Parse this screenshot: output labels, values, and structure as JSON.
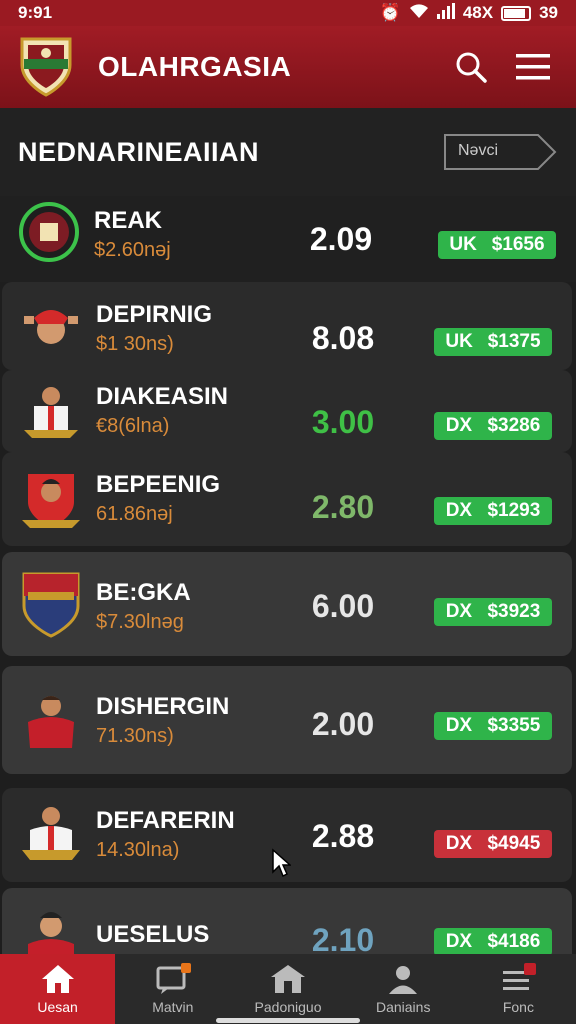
{
  "status_bar": {
    "time": "9:91",
    "signal_text": "48X",
    "battery": "39"
  },
  "header": {
    "title": "OLAHRGASIA",
    "search_icon": "search-icon",
    "menu_icon": "menu-icon"
  },
  "section": {
    "title": "NEDNARINEAIIAN",
    "next_label": "Nəvci"
  },
  "rows": [
    {
      "name": "REAK",
      "sub": "$2.60nəj",
      "odds": "2.09",
      "odds_color": "#ffffff",
      "pill_code": "UK",
      "pill_amount": "$1656",
      "pill_color": "green"
    },
    {
      "name": "DEPIRNIG",
      "sub": "$1 30ns)",
      "odds": "8.08",
      "odds_color": "#ffffff",
      "pill_code": "UK",
      "pill_amount": "$1375",
      "pill_color": "green"
    },
    {
      "name": "DIAKEASIN",
      "sub": "€8(6lna)",
      "odds": "3.00",
      "odds_color": "#3fc046",
      "pill_code": "DX",
      "pill_amount": "$3286",
      "pill_color": "green"
    },
    {
      "name": "BEPEENIG",
      "sub": "61.86nəj",
      "odds": "2.80",
      "odds_color": "#7fb86a",
      "pill_code": "DX",
      "pill_amount": "$1293",
      "pill_color": "green"
    },
    {
      "name": "BE:GKA",
      "sub": "$7.30lnəg",
      "odds": "6.00",
      "odds_color": "#e6e6e6",
      "pill_code": "DX",
      "pill_amount": "$3923",
      "pill_color": "green"
    },
    {
      "name": "DISHERGIN",
      "sub": "71.30ns)",
      "odds": "2.00",
      "odds_color": "#e6e6e6",
      "pill_code": "DX",
      "pill_amount": "$3355",
      "pill_color": "green"
    },
    {
      "name": "DEFARERIN",
      "sub": "14.30lna)",
      "odds": "2.88",
      "odds_color": "#ffffff",
      "pill_code": "DX",
      "pill_amount": "$4945",
      "pill_color": "red"
    },
    {
      "name": "UESELUS",
      "sub": "",
      "odds": "2.10",
      "odds_color": "#6fa3bf",
      "pill_code": "DX",
      "pill_amount": "$4186",
      "pill_color": "green"
    }
  ],
  "nav": [
    {
      "label": "Uesan",
      "icon": "home-icon"
    },
    {
      "label": "Matvin",
      "icon": "chat-icon"
    },
    {
      "label": "Padoniguo",
      "icon": "stadium-icon"
    },
    {
      "label": "Daniains",
      "icon": "user-icon"
    },
    {
      "label": "Fonc",
      "icon": "list-icon"
    }
  ]
}
